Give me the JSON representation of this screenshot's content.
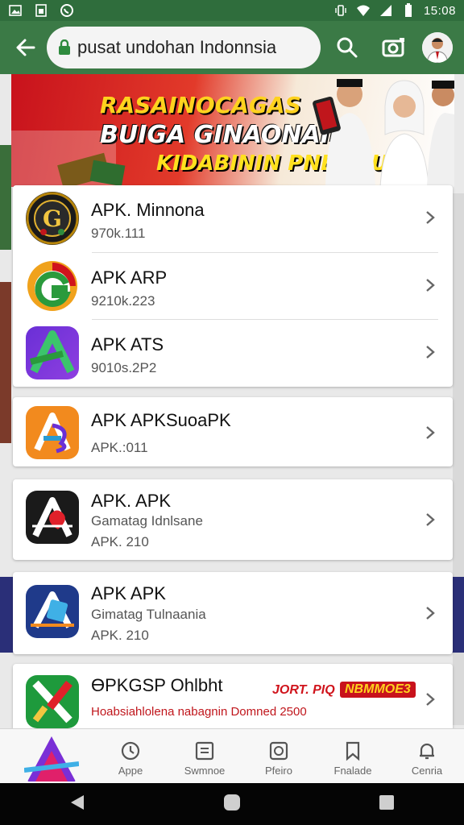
{
  "status_bar": {
    "time": "15:08",
    "icons": [
      "image-icon",
      "sim-icon",
      "whatsapp-icon",
      "vibrate-icon",
      "wifi-icon",
      "signal-icon",
      "battery-icon"
    ]
  },
  "browser": {
    "url": "pusat undohan Indonnsia",
    "accent": "#3b7a46"
  },
  "banner": {
    "line1": "RASAINOCAGAS",
    "line2": "BUIGA GINAONAIN",
    "line3": "KIDABININ PNEPMUS"
  },
  "apps": [
    {
      "title": "APK. Minnona",
      "meta": "970k.111"
    },
    {
      "title": "APK ARP",
      "meta": "9210k.223"
    },
    {
      "title": "APK ATS",
      "meta": "9010s.2P2"
    },
    {
      "title": "APK APKSuoaPK",
      "meta": "APK.:011"
    },
    {
      "title": "APK. APK",
      "subtitle": "Gamatag Idnlsane",
      "meta": "APK. 210"
    },
    {
      "title": "APK  APK",
      "subtitle": "Gimatag Tulnaania",
      "meta": "APK. 210"
    },
    {
      "title": "ӨPKGSP Ohlbht",
      "promo": "Ноabsiahlolena nabagnin Domned 2500",
      "tag1": "JORT. PIQ",
      "tag2": "NBMMOE3"
    }
  ],
  "bottom_nav": {
    "items": [
      {
        "label": "Appe",
        "icon": "clock-icon"
      },
      {
        "label": "Swmnoe",
        "icon": "box-icon"
      },
      {
        "label": "Pfeiro",
        "icon": "photo-icon"
      },
      {
        "label": "Fnalade",
        "icon": "bookmark-icon"
      },
      {
        "label": "Cenria",
        "icon": "bell-icon"
      }
    ]
  }
}
